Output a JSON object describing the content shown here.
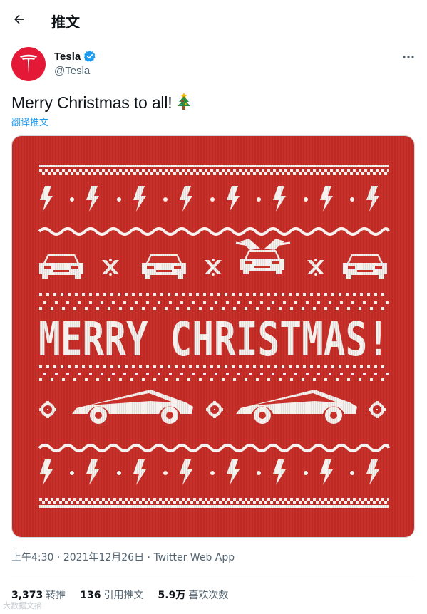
{
  "header": {
    "title": "推文",
    "back_icon": "arrow-left-icon"
  },
  "author": {
    "name": "Tesla",
    "handle": "@Tesla",
    "verified_icon": "verified-badge-icon",
    "avatar_icon": "tesla-logo-icon",
    "avatar_color": "#e31937"
  },
  "tweet": {
    "text": "Merry Christmas to all!",
    "emoji_icon": "christmas-tree-icon",
    "translate_label": "翻译推文",
    "media": {
      "kind": "knit-sweater-image",
      "headline": "MERRY CHRISTMAS!",
      "background": "#c8302a",
      "knit_color": "#f4f1ee"
    }
  },
  "meta": {
    "time": "上午4:30",
    "sep1": "·",
    "date": "2021年12月26日",
    "sep2": "·",
    "app": "Twitter Web App"
  },
  "stats": [
    {
      "value": "3,373",
      "label": "转推"
    },
    {
      "value": "136",
      "label": "引用推文"
    },
    {
      "value": "5.9万",
      "label": "喜欢次数"
    }
  ],
  "watermark": "大数据文摘",
  "colors": {
    "accent": "#1d9bf0",
    "text": "#0f1419",
    "secondary": "#536471"
  }
}
